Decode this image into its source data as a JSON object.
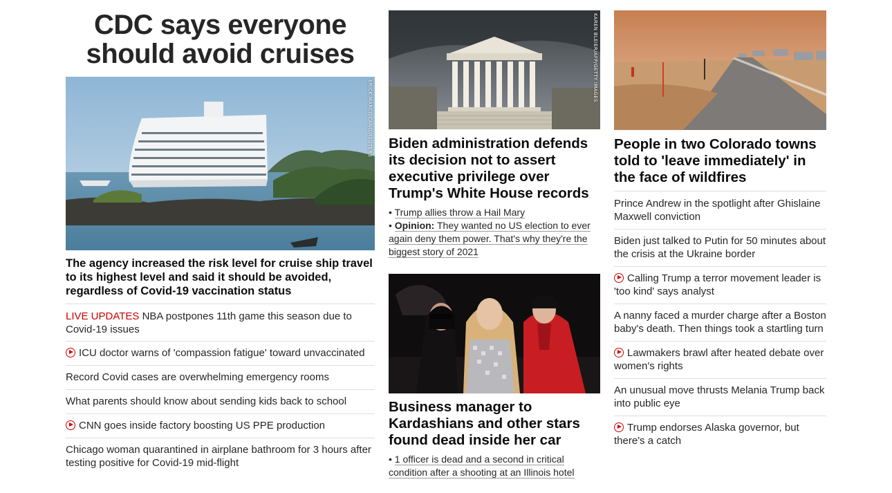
{
  "col1": {
    "headline": "CDC says everyone should avoid cruises",
    "image_credit": "ERICK MARCISCANO/REUTERS",
    "subhead": "The agency increased the risk level for cruise ship travel to its highest level and said it should be avoided, regardless of Covid-19 vaccination status",
    "links": [
      {
        "tag": "LIVE UPDATES",
        "text": " NBA postpones 11th game this season due to Covid-19 issues"
      },
      {
        "text": "ICU doctor warns of 'compassion fatigue' toward unvaccinated",
        "video": true
      },
      {
        "text": "Record Covid cases are overwhelming emergency rooms"
      },
      {
        "text": "What parents should know about sending kids back to school"
      },
      {
        "text": "CNN goes inside factory boosting US PPE production",
        "video": true
      },
      {
        "text": "Chicago woman quarantined in airplane bathroom for 3 hours after testing positive for Covid-19 mid-flight"
      }
    ]
  },
  "col2": {
    "card1": {
      "image_credit": "KAREN BLEIER/AFP/GETTY IMAGES",
      "title": "Biden administration defends its decision not to assert executive privilege over Trump's White House records",
      "bullet1": "Trump allies throw a Hail Mary",
      "bullet2_label": "Opinion:",
      "bullet2": " They wanted no US election to ever again deny them power. That's why they're the biggest story of 2021"
    },
    "card2": {
      "title": "Business manager to Kardashians and other stars found dead inside her car",
      "bullet1": "1 officer is dead and a second in critical condition after a shooting at an Illinois hotel"
    }
  },
  "col3": {
    "title": "People in two Colorado towns told to 'leave immediately' in the face of wildfires",
    "links": [
      {
        "text": "Prince Andrew in the spotlight after Ghislaine Maxwell conviction"
      },
      {
        "text": "Biden just talked to Putin for 50 minutes about the crisis at the Ukraine border"
      },
      {
        "text": "Calling Trump a terror movement leader is 'too kind' says analyst",
        "video": true
      },
      {
        "text": "A nanny faced a murder charge after a Boston baby's death. Then things took a startling turn"
      },
      {
        "text": "Lawmakers brawl after heated debate over women's rights",
        "video": true
      },
      {
        "text": "An unusual move thrusts Melania Trump back into public eye"
      },
      {
        "text": "Trump endorses Alaska governor, but there's a catch",
        "video": true
      }
    ]
  },
  "colors": {
    "accent": "#cc0000",
    "divider": "#dedede",
    "text": "#0c0c0c"
  }
}
